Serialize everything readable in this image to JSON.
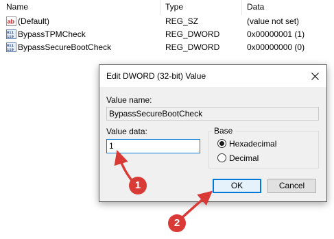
{
  "columns": {
    "name": "Name",
    "type": "Type",
    "data": "Data"
  },
  "rows": [
    {
      "name": "(Default)",
      "type": "REG_SZ",
      "data": "(value not set)",
      "icon": "string-value-icon"
    },
    {
      "name": "BypassTPMCheck",
      "type": "REG_DWORD",
      "data": "0x00000001 (1)",
      "icon": "binary-value-icon"
    },
    {
      "name": "BypassSecureBootCheck",
      "type": "REG_DWORD",
      "data": "0x00000000 (0)",
      "icon": "binary-value-icon"
    }
  ],
  "dialog": {
    "title": "Edit DWORD (32-bit) Value",
    "value_name_label": "Value name:",
    "value_name": "BypassSecureBootCheck",
    "value_data_label": "Value data:",
    "value_data": "1",
    "base_label": "Base",
    "base_options": [
      {
        "label": "Hexadecimal",
        "selected": true
      },
      {
        "label": "Decimal",
        "selected": false
      }
    ],
    "ok_label": "OK",
    "cancel_label": "Cancel"
  },
  "annotations": [
    {
      "number": "1",
      "color": "#d93a36"
    },
    {
      "number": "2",
      "color": "#d93a36"
    }
  ]
}
